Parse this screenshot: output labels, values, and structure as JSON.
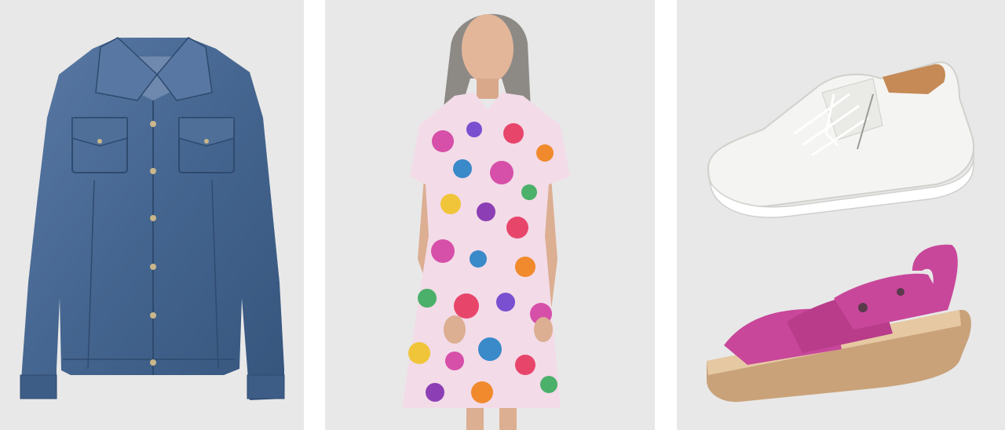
{
  "products": [
    {
      "name": "denim-jacket",
      "color": "#4a6a93"
    },
    {
      "name": "floral-dress",
      "color": "#d64fa8"
    },
    {
      "name": "white-sneaker",
      "color": "#f2f2f0"
    },
    {
      "name": "pink-sandal",
      "color": "#c8479a"
    }
  ],
  "colors": {
    "panel_bg": "#e8e8e8",
    "page_bg": "#ffffff"
  }
}
